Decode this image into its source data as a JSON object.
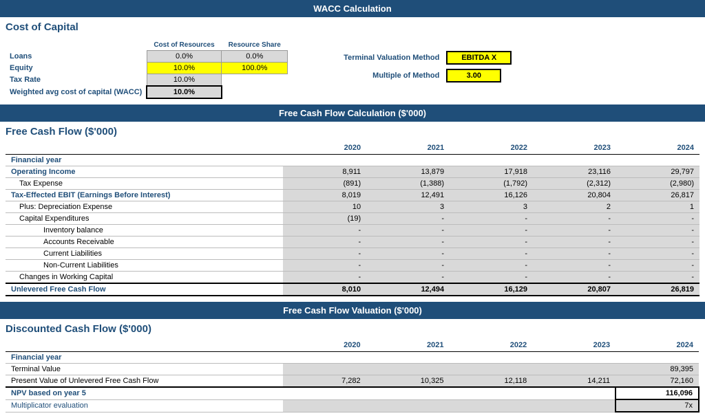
{
  "page": {
    "main_title": "WACC Calculation",
    "wacc_section": {
      "title": "Cost of Capital",
      "table_headers": {
        "cost_resources": "Cost of Resources",
        "resource_share": "Resource Share"
      },
      "rows": [
        {
          "label": "Loans",
          "cost": "0.0%",
          "share": "0.0%"
        },
        {
          "label": "Equity",
          "cost": "10.0%",
          "share": "100.0%"
        },
        {
          "label": "Tax Rate",
          "cost": "10.0%",
          "share": ""
        },
        {
          "label": "Weighted avg cost of capital (WACC)",
          "cost": "10.0%",
          "share": ""
        }
      ],
      "terminal_valuation_label": "Terminal Valuation Method",
      "terminal_valuation_value": "EBITDA X",
      "multiple_method_label": "Multiple of Method",
      "multiple_method_value": "3.00"
    },
    "fcf_section": {
      "section_header": "Free Cash Flow Calculation ($'000)",
      "title": "Free Cash Flow ($'000)",
      "years": [
        "2020",
        "2021",
        "2022",
        "2023",
        "2024"
      ],
      "rows": [
        {
          "label": "Financial year",
          "indent": 0,
          "is_header": true,
          "values": [
            "",
            "",
            "",
            "",
            ""
          ]
        },
        {
          "label": "Operating Income",
          "indent": 0,
          "bold": true,
          "values": [
            "8,911",
            "13,879",
            "17,918",
            "23,116",
            "29,797"
          ]
        },
        {
          "label": "Tax Expense",
          "indent": 1,
          "values": [
            "(891)",
            "(1,388)",
            "(1,792)",
            "(2,312)",
            "(2,980)"
          ]
        },
        {
          "label": "Tax-Effected EBIT (Earnings Before Interest)",
          "indent": 0,
          "bold": true,
          "values": [
            "8,019",
            "12,491",
            "16,126",
            "20,804",
            "26,817"
          ]
        },
        {
          "label": "Plus: Depreciation Expense",
          "indent": 1,
          "values": [
            "10",
            "3",
            "3",
            "2",
            "1"
          ]
        },
        {
          "label": "Capital Expenditures",
          "indent": 1,
          "values": [
            "(19)",
            "-",
            "-",
            "-",
            "-"
          ]
        },
        {
          "label": "Inventory balance",
          "indent": 3,
          "values": [
            "-",
            "-",
            "-",
            "-",
            "-"
          ]
        },
        {
          "label": "Accounts Receivable",
          "indent": 3,
          "values": [
            "-",
            "-",
            "-",
            "-",
            "-"
          ]
        },
        {
          "label": "Current Liabilities",
          "indent": 3,
          "values": [
            "-",
            "-",
            "-",
            "-",
            "-"
          ]
        },
        {
          "label": "Non-Current Liabilities",
          "indent": 3,
          "values": [
            "-",
            "-",
            "-",
            "-",
            "-"
          ]
        },
        {
          "label": "Changes in Working Capital",
          "indent": 1,
          "values": [
            "-",
            "-",
            "-",
            "-",
            "-"
          ]
        },
        {
          "label": "Unlevered Free Cash Flow",
          "indent": 0,
          "bold": true,
          "unlevered": true,
          "values": [
            "8,010",
            "12,494",
            "16,129",
            "20,807",
            "26,819"
          ]
        }
      ]
    },
    "dcf_section": {
      "section_header": "Free Cash Flow Valuation ($'000)",
      "title": "Discounted Cash Flow ($'000)",
      "years": [
        "2020",
        "2021",
        "2022",
        "2023",
        "2024"
      ],
      "rows": [
        {
          "label": "Financial year",
          "indent": 0,
          "is_header": true,
          "values": [
            "",
            "",
            "",
            "",
            ""
          ]
        },
        {
          "label": "Terminal Value",
          "indent": 0,
          "values": [
            "",
            "",
            "",
            "",
            "89,395"
          ]
        },
        {
          "label": "Present Value of Unlevered Free Cash Flow",
          "indent": 0,
          "values": [
            "7,282",
            "10,325",
            "12,118",
            "14,211",
            "72,160"
          ]
        },
        {
          "label": "NPV based on year 5",
          "indent": 0,
          "bold": true,
          "npv": true,
          "values": [
            "",
            "",
            "",
            "",
            "116,096"
          ]
        },
        {
          "label": "Multiplicator evaluation",
          "indent": 0,
          "mult": true,
          "values": [
            "",
            "",
            "",
            "",
            "7x"
          ]
        }
      ]
    }
  }
}
